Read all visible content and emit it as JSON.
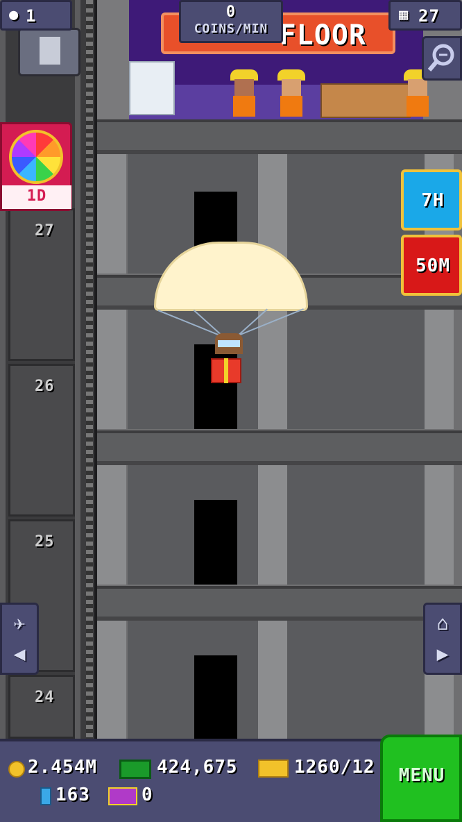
{
  "topbar": {
    "people_count": "1",
    "coins_per_min_value": "0",
    "coins_per_min_label": "COINS/MIN",
    "floor_count": "27"
  },
  "build_sign": {
    "label": "FLOOR"
  },
  "bux_wheel": {
    "timer": "1D"
  },
  "timers": {
    "first": "7H",
    "second": "50M"
  },
  "floors": [
    "27",
    "26",
    "25",
    "24"
  ],
  "bottombar": {
    "coins": "2.454M",
    "bux": "424,675",
    "golden_tickets": "1260/12",
    "elevator_tickets": "163",
    "special_tickets": "0",
    "menu_label": "MENU"
  },
  "colors": {
    "purple_ui": "#4b4c72",
    "menu_green": "#20c020",
    "wheel_red": "#d41c52",
    "timer_blue": "#1aa8e8",
    "timer_red": "#d81818"
  },
  "icons": [
    "people-icon",
    "building-icon",
    "zoom-icon",
    "color-wheel-icon",
    "plane-icon",
    "arrow-left-icon",
    "home-icon",
    "arrow-right-icon",
    "coin-icon",
    "bux-icon",
    "golden-ticket-icon",
    "elevator-ticket-icon",
    "special-ticket-icon"
  ]
}
